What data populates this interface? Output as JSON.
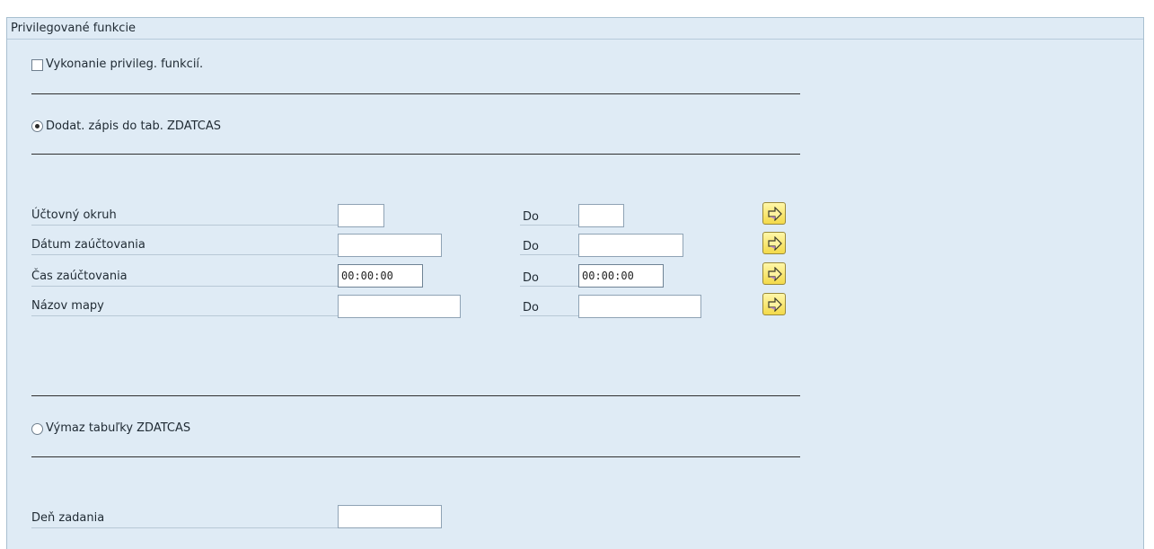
{
  "frame": {
    "title": "Privilegované funkcie"
  },
  "privileged": {
    "checkbox_label": "Vykonanie privileg. funkcií.",
    "checked": false
  },
  "options": {
    "insert_label": "Dodat. zápis do tab. ZDATCAS",
    "insert_selected": true,
    "delete_label": "Výmaz tabuľky ZDATCAS",
    "delete_selected": false
  },
  "ranges": {
    "to_label": "Do",
    "rows": [
      {
        "label": "Účtovný okruh",
        "from": "",
        "to": ""
      },
      {
        "label": "Dátum zaúčtovania",
        "from": "",
        "to": ""
      },
      {
        "label": "Čas zaúčtovania",
        "from": "00:00:00",
        "to": "00:00:00"
      },
      {
        "label": "Názov mapy",
        "from": "",
        "to": ""
      }
    ]
  },
  "entry_day": {
    "label": "Deň zadania",
    "value": ""
  },
  "icons": {
    "multi_select": "arrow-right-icon",
    "accent": "#f3d94a"
  }
}
